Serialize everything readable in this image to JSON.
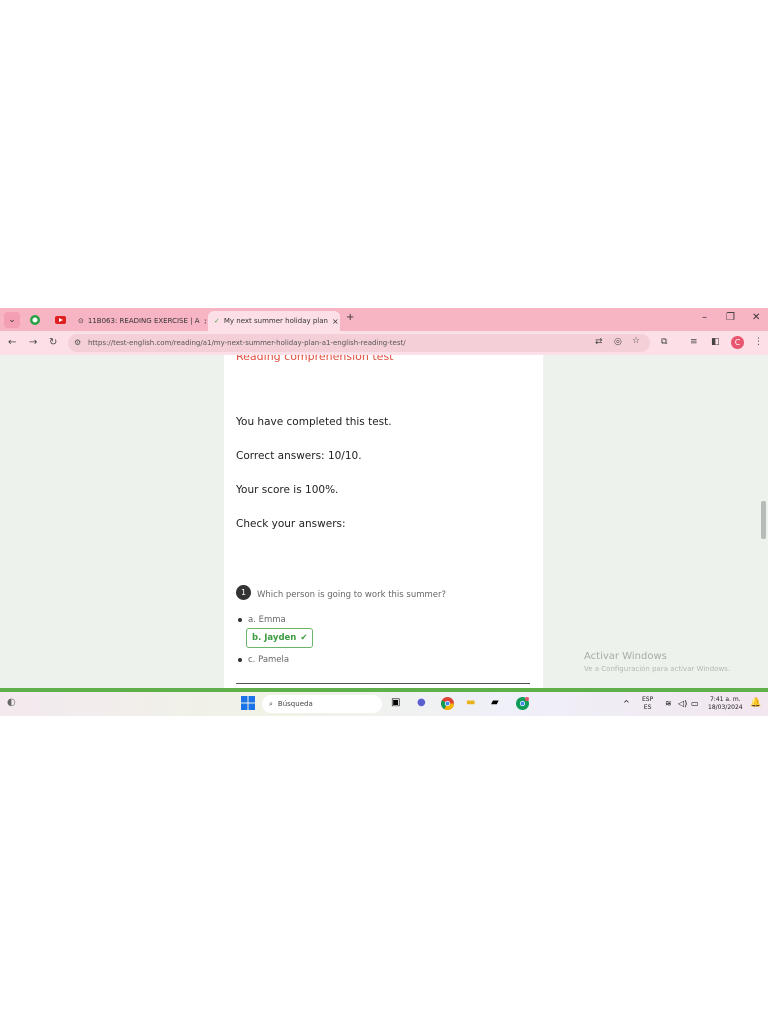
{
  "browser": {
    "tabs": [
      {
        "label": "11B063: READING EXERCISE | A",
        "close": "×"
      },
      {
        "label": "My next summer holiday plan",
        "close": "×"
      }
    ],
    "new_tab": "+",
    "window_controls": [
      "–",
      "❐",
      "✕"
    ],
    "url": "https://test-english.com/reading/a1/my-next-summer-holiday-plan-a1-english-reading-test/",
    "profile_initial": "C"
  },
  "page": {
    "heading": "Reading comprehension test",
    "completed": "You have completed this test.",
    "correct_label": "Correct answers: ",
    "correct_value": "10/10.",
    "score": "Your score is 100%.",
    "check": "Check your answers:",
    "question": {
      "number": "1",
      "text": "Which person is going to work this summer?",
      "options": [
        "a. Emma",
        "b. Jayden",
        "c. Pamela"
      ],
      "correct_option": "b. Jayden"
    }
  },
  "watermark": {
    "title": "Activar Windows",
    "subtitle": "Ve a Configuración para activar Windows."
  },
  "taskbar": {
    "search_placeholder": "Búsqueda",
    "lang_top": "ESP",
    "lang_bottom": "ES",
    "time": "7:41 a. m.",
    "date": "18/03/2024"
  },
  "colors": {
    "tab_bar": "#f7b4c3",
    "heading_red": "#e14b3b",
    "correct_green": "#3c9b41",
    "page_bg": "#eef2ec"
  }
}
